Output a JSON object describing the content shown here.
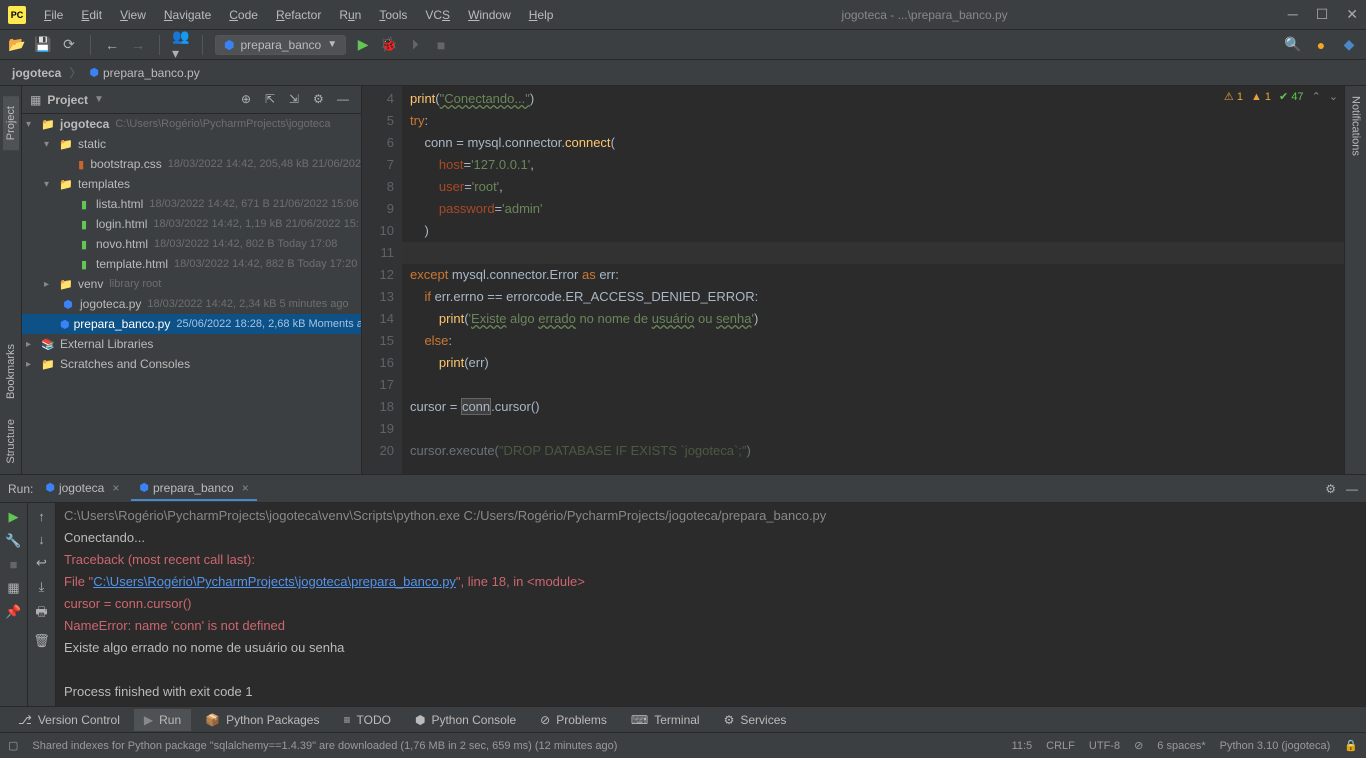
{
  "window": {
    "title": "jogoteca - ...\\prepara_banco.py"
  },
  "menu": {
    "file": "File",
    "edit": "Edit",
    "view": "View",
    "navigate": "Navigate",
    "code": "Code",
    "refactor": "Refactor",
    "run": "Run",
    "tools": "Tools",
    "vcs": "VCS",
    "window": "Window",
    "help": "Help"
  },
  "toolbar": {
    "run_config": "prepara_banco"
  },
  "breadcrumb": {
    "project": "jogoteca",
    "file": "prepara_banco.py"
  },
  "project_panel": {
    "title": "Project",
    "tree": {
      "root": "jogoteca",
      "root_path": "C:\\Users\\Rogério\\PycharmProjects\\jogoteca",
      "static": "static",
      "bootstrap": "bootstrap.css",
      "bootstrap_meta": "18/03/2022 14:42, 205,48 kB 21/06/202",
      "templates": "templates",
      "lista": "lista.html",
      "lista_meta": "18/03/2022 14:42, 671 B 21/06/2022 15:06",
      "login": "login.html",
      "login_meta": "18/03/2022 14:42, 1,19 kB 21/06/2022 15:",
      "novo": "novo.html",
      "novo_meta": "18/03/2022 14:42, 802 B Today 17:08",
      "template": "template.html",
      "template_meta": "18/03/2022 14:42, 882 B Today 17:20",
      "venv": "venv",
      "venv_meta": "library root",
      "jogoteca_py": "jogoteca.py",
      "jogoteca_py_meta": "18/03/2022 14:42, 2,34 kB 5 minutes ago",
      "prepara": "prepara_banco.py",
      "prepara_meta": "25/06/2022 18:28, 2,68 kB Moments a",
      "ext_lib": "External Libraries",
      "scratches": "Scratches and Consoles"
    }
  },
  "editor": {
    "lines": [
      "4",
      "5",
      "6",
      "7",
      "8",
      "9",
      "10",
      "11",
      "12",
      "13",
      "14",
      "15",
      "16",
      "17",
      "18",
      "19",
      "20"
    ],
    "code": {
      "l4_print": "print",
      "l4_str": "\"Conectando...\"",
      "l5_try": "try",
      "l6_conn": "conn = mysql.connector.",
      "l6_connect": "connect",
      "l7_host": "host",
      "l7_hostval": "'127.0.0.1'",
      "l8_user": "user",
      "l8_userval": "'root'",
      "l9_pass": "password",
      "l9_passval": "'admin'",
      "l12_except": "except",
      "l12_mid": " mysql.connector.Error ",
      "l12_as": "as",
      "l12_err": " err:",
      "l13_if": "if",
      "l13_rest": " err.errno == errorcode.ER_ACCESS_DENIED_ERROR:",
      "l14_print": "print",
      "l14_s1": "'",
      "l14_s2": "Existe",
      "l14_s3": " algo ",
      "l14_s4": "errado",
      "l14_s5": " no nome de ",
      "l14_s6": "usuário",
      "l14_s7": " ou ",
      "l14_s8": "senha",
      "l14_s9": "'",
      "l15_else": "else",
      "l16_print": "print",
      "l16_err": "(err)",
      "l18_cursor": "cursor = ",
      "l18_conn": "conn",
      "l18_rest": ".cursor()",
      "l20_exec": "cursor.execute(",
      "l20_str": "\"DROP DATABASE IF EXISTS `jogoteca`;\""
    },
    "inspections": {
      "warn1": "1",
      "warn2": "1",
      "weak": "47"
    }
  },
  "run_panel": {
    "label": "Run:",
    "tab1": "jogoteca",
    "tab2": "prepara_banco",
    "console": {
      "l1": "C:\\Users\\Rogério\\PycharmProjects\\jogoteca\\venv\\Scripts\\python.exe C:/Users/Rogério/PycharmProjects/jogoteca/prepara_banco.py",
      "l2": "Conectando...",
      "l3": "Traceback (most recent call last):",
      "l4a": "  File \"",
      "l4_link": "C:\\Users\\Rogério\\PycharmProjects\\jogoteca\\prepara_banco.py",
      "l4b": "\", line 18, in <module>",
      "l5": "    cursor = conn.cursor()",
      "l6": "NameError: name 'conn' is not defined",
      "l7": "Existe algo errado no nome de usuário ou senha",
      "l8": "Process finished with exit code 1"
    }
  },
  "bottom_tabs": {
    "vcs": "Version Control",
    "run": "Run",
    "pkg": "Python Packages",
    "todo": "TODO",
    "pyconsole": "Python Console",
    "problems": "Problems",
    "terminal": "Terminal",
    "services": "Services"
  },
  "statusbar": {
    "msg": "Shared indexes for Python package \"sqlalchemy==1.4.39\" are downloaded (1,76 MB in 2 sec, 659 ms) (12 minutes ago)",
    "pos": "11:5",
    "eol": "CRLF",
    "enc": "UTF-8",
    "indent": "6 spaces*",
    "interp": "Python 3.10 (jogoteca)"
  },
  "side_tabs": {
    "project": "Project",
    "bookmarks": "Bookmarks",
    "structure": "Structure",
    "notifications": "Notifications"
  }
}
